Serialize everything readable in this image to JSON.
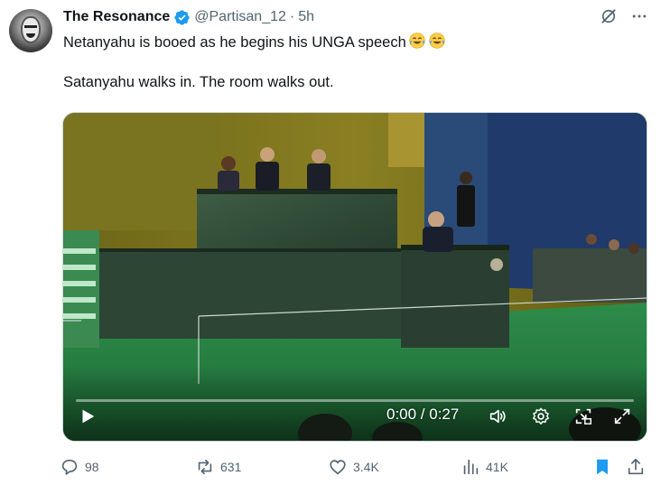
{
  "author": {
    "name": "The Resonance",
    "handle": "@Partisan_12",
    "separator": "·",
    "time": "5h",
    "verified": true
  },
  "tweet": {
    "line1": "Netanyahu is booed as he begins his UNGA speech",
    "emojis": [
      "face-with-tears-of-joy",
      "face-with-tears-of-joy"
    ],
    "line2": "Satanyahu walks in. The room walks out."
  },
  "video": {
    "timecode": "0:00 / 0:27",
    "progress": 0.0
  },
  "actions": {
    "replies": "98",
    "reposts": "631",
    "likes": "3.4K",
    "views": "41K"
  },
  "colors": {
    "text": "#0f1419",
    "muted": "#536471",
    "verified_blue": "#1d9bf0",
    "bookmark_blue": "#1d9bf0"
  },
  "icons": [
    "grok-icon",
    "more-icon",
    "play-icon",
    "volume-icon",
    "settings-icon",
    "pip-icon",
    "fullscreen-icon",
    "reply-icon",
    "repost-icon",
    "like-icon",
    "views-icon",
    "bookmark-icon",
    "share-icon"
  ]
}
